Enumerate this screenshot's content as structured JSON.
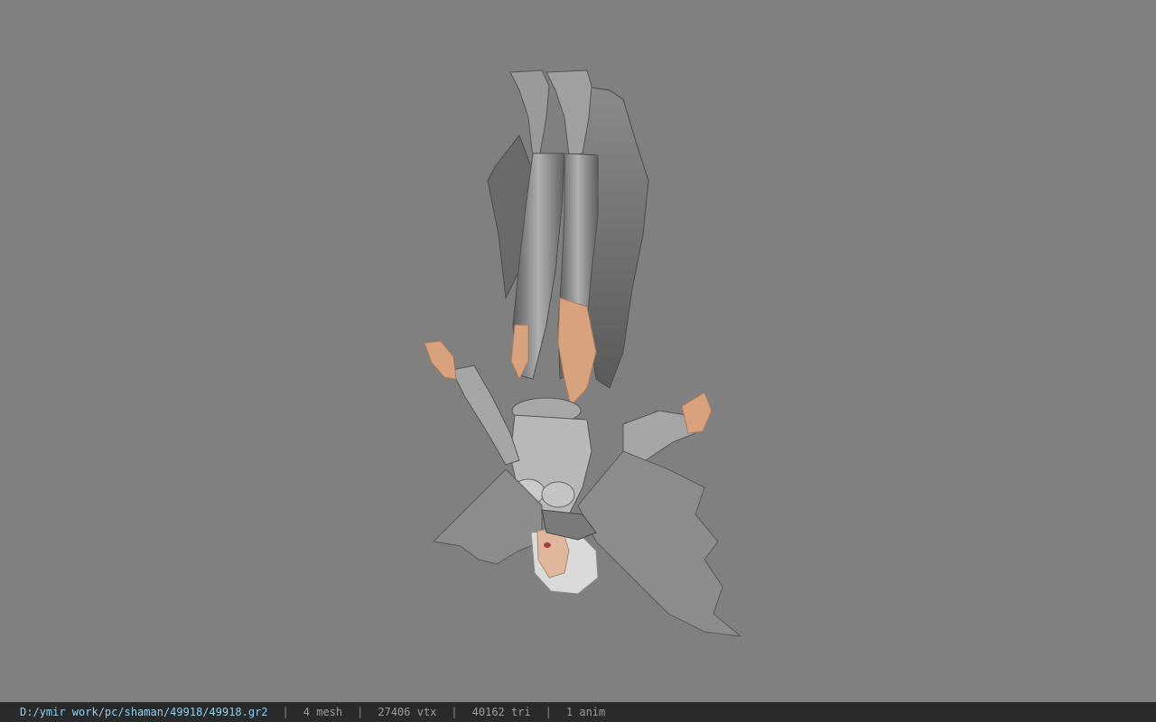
{
  "viewer": {
    "background_color": "#808080",
    "model": {
      "description_icon": "character-model",
      "orientation": "upside-down"
    }
  },
  "status_bar": {
    "file_path": "D:/ymir work/pc/shaman/49918/49918.gr2",
    "mesh_count": "4 mesh",
    "vertex_count": "27406 vtx",
    "triangle_count": "40162 tri",
    "anim_count": "1 anim",
    "separator": "|",
    "path_color": "#8fd0f0",
    "bar_color": "#2a2a2a"
  }
}
